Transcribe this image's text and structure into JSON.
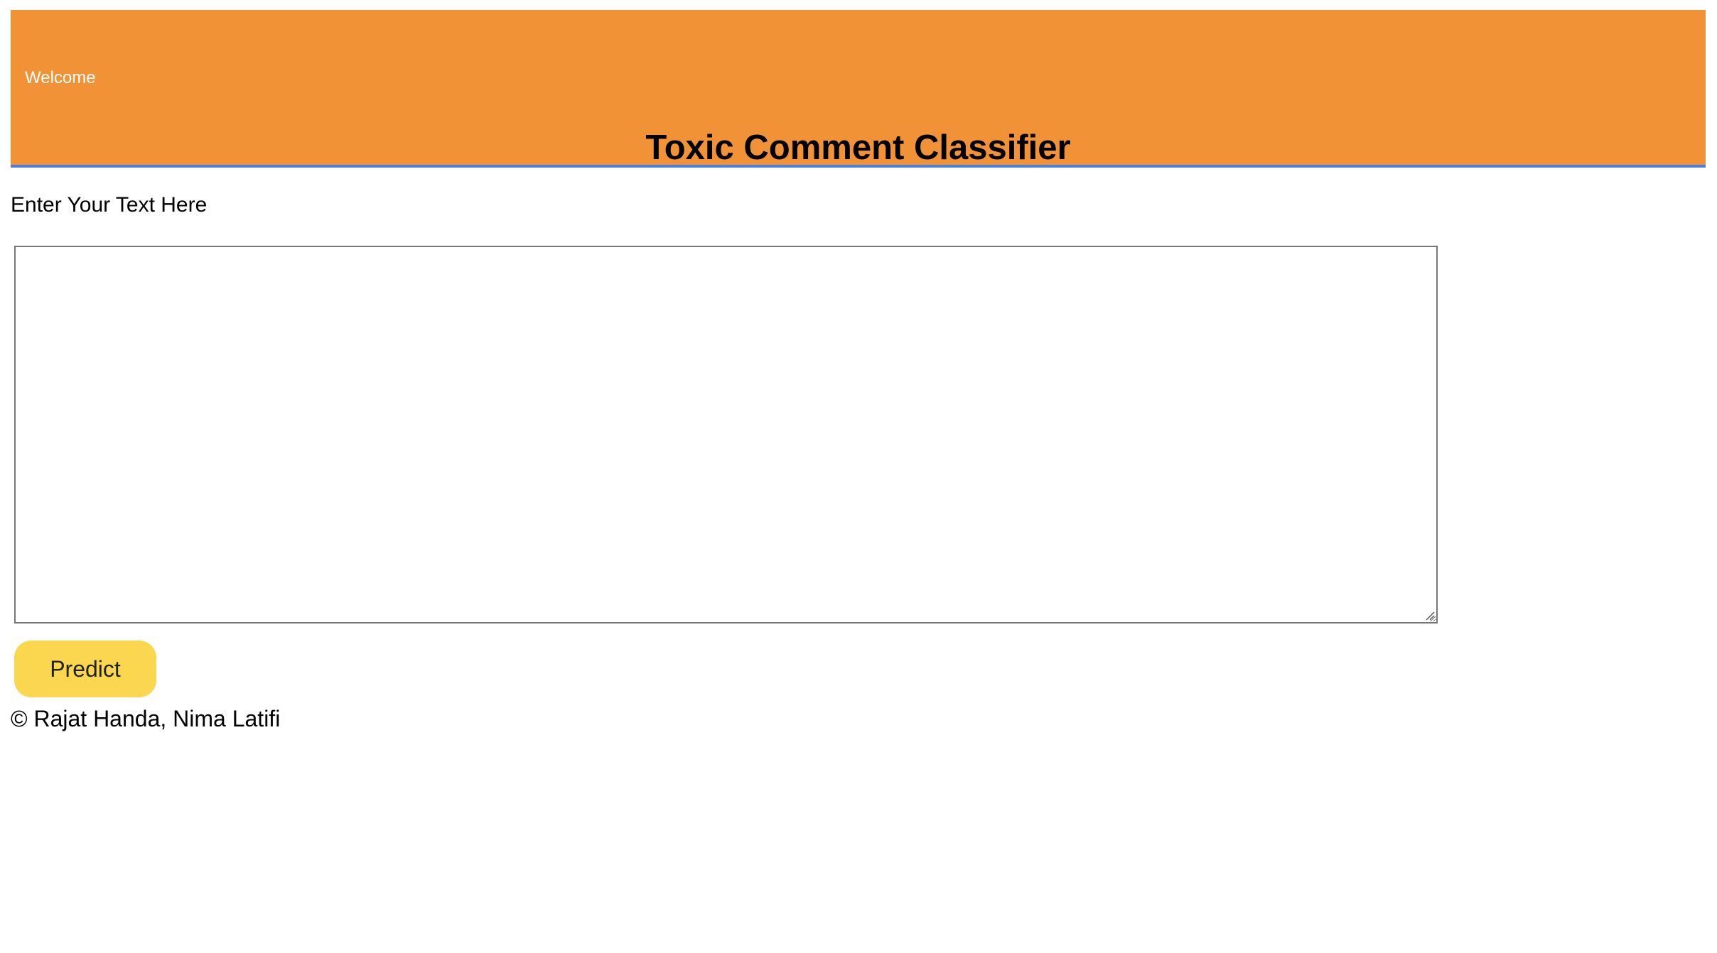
{
  "header": {
    "welcome_text": "Welcome",
    "title": "Toxic Comment Classifier",
    "background_color": "#f29236",
    "border_color": "#4a7fe0"
  },
  "form": {
    "input_label": "Enter Your Text Here",
    "textarea_value": "",
    "textarea_placeholder": "",
    "predict_label": "Predict",
    "predict_color": "#fad74f"
  },
  "footer": {
    "copyright": "© Rajat Handa, Nima Latifi"
  }
}
